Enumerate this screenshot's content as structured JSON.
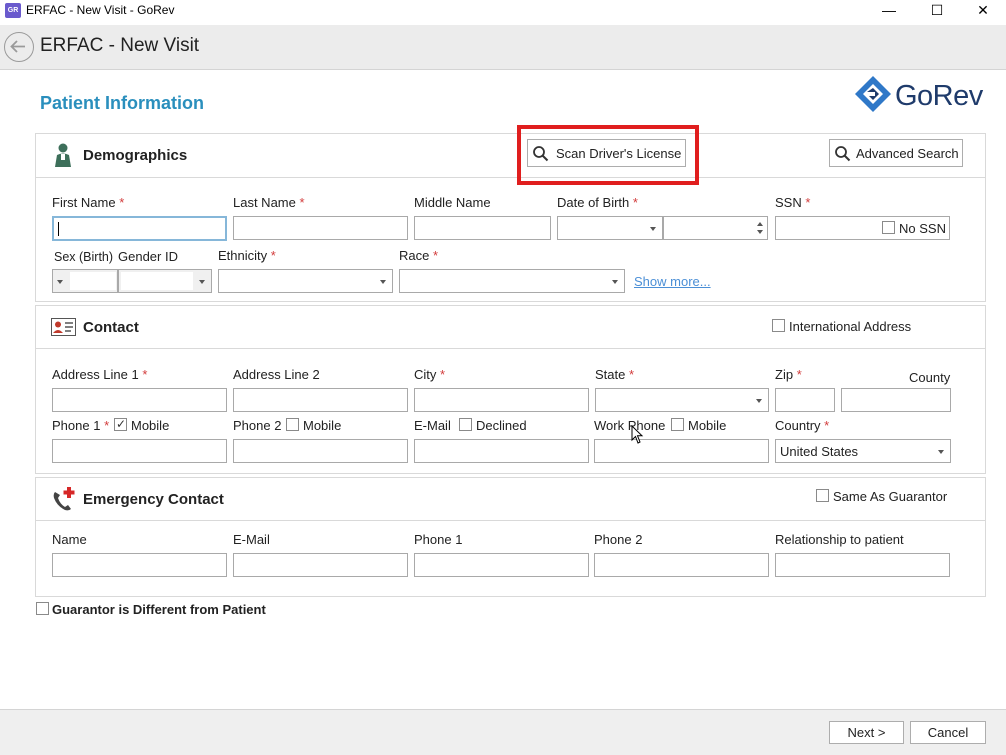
{
  "window": {
    "title": "ERFAC - New Visit - GoRev",
    "app_icon": "gorev-app-icon",
    "controls": {
      "minimize": "—",
      "maximize": "☐",
      "close": "✕"
    }
  },
  "header": {
    "title": "ERFAC - New Visit"
  },
  "page": {
    "section_title": "Patient Information",
    "logo_text": "GoRev"
  },
  "demographics": {
    "title": "Demographics",
    "scan_label": "Scan Driver's License",
    "advanced_label": "Advanced Search",
    "fields": {
      "first_name": "First Name",
      "last_name": "Last Name",
      "middle_name": "Middle Name",
      "dob": "Date of Birth",
      "ssn": "SSN",
      "no_ssn": "No SSN",
      "sex_birth": "Sex (Birth)",
      "gender_id": "Gender ID",
      "ethnicity": "Ethnicity",
      "race": "Race",
      "show_more": "Show more..."
    },
    "required_mark": "*"
  },
  "contact": {
    "title": "Contact",
    "intl_address": "International Address",
    "fields": {
      "address1": "Address Line 1",
      "address2": "Address Line 2",
      "city": "City",
      "state": "State",
      "zip": "Zip",
      "county": "County",
      "phone1": "Phone 1",
      "mobile": "Mobile",
      "phone2": "Phone 2",
      "email": "E-Mail",
      "declined": "Declined",
      "work_phone": "Work Phone",
      "country": "Country"
    },
    "country_value": "United States"
  },
  "emergency": {
    "title": "Emergency Contact",
    "same_as_guarantor": "Same As Guarantor",
    "fields": {
      "name": "Name",
      "email": "E-Mail",
      "phone1": "Phone 1",
      "phone2": "Phone 2",
      "relationship": "Relationship to patient"
    }
  },
  "guarantor_diff": "Guarantor is Different from Patient",
  "footer": {
    "next": "Next >",
    "cancel": "Cancel"
  },
  "colors": {
    "accent": "#2a8fbd",
    "required": "#d23b3b",
    "highlight": "#e01e1e",
    "link": "#4b8fd6"
  }
}
